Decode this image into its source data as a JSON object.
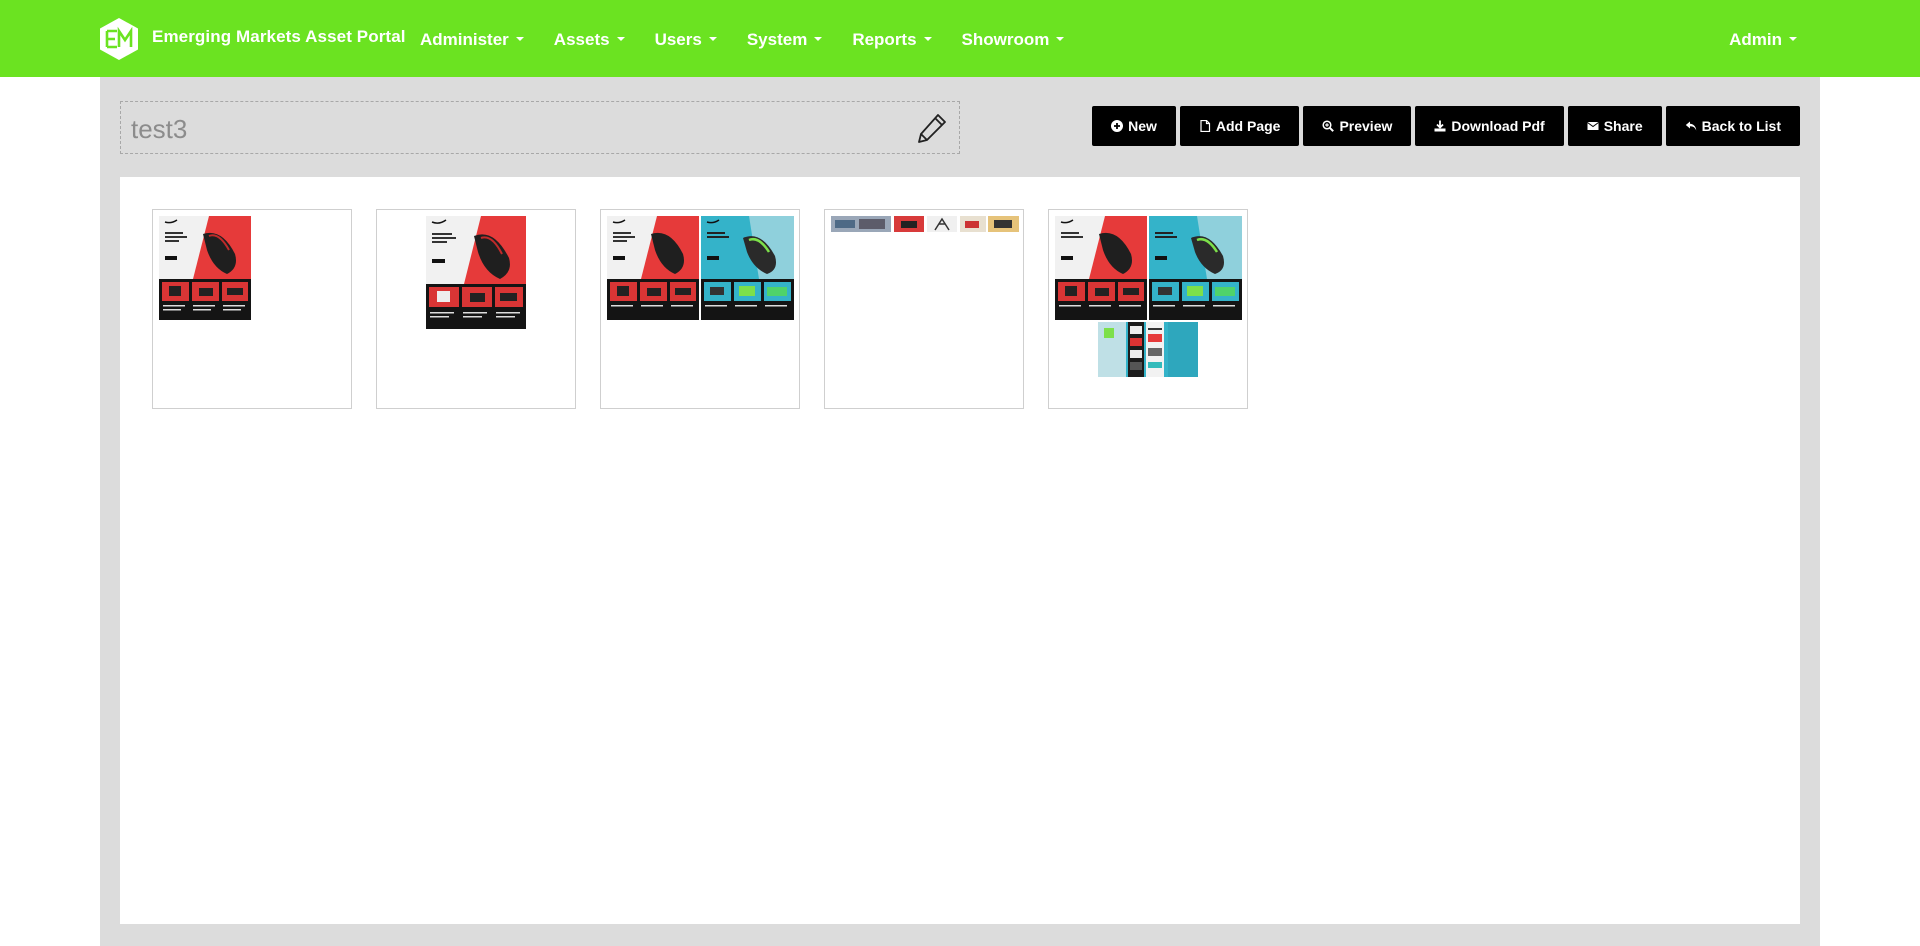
{
  "navbar": {
    "brand_title": "Emerging Markets Asset Portal",
    "items": [
      {
        "label": "Administer"
      },
      {
        "label": "Assets"
      },
      {
        "label": "Users"
      },
      {
        "label": "System"
      },
      {
        "label": "Reports"
      },
      {
        "label": "Showroom"
      }
    ],
    "user_menu": "Admin"
  },
  "document": {
    "title": "test3"
  },
  "toolbar": {
    "new_label": "New",
    "add_page_label": "Add Page",
    "preview_label": "Preview",
    "download_pdf_label": "Download Pdf",
    "share_label": "Share",
    "back_label": "Back to List"
  },
  "pages": [
    {
      "name": "page-1"
    },
    {
      "name": "page-2"
    },
    {
      "name": "page-3"
    },
    {
      "name": "page-4"
    },
    {
      "name": "page-5"
    }
  ],
  "colors": {
    "brand_green": "#6be321",
    "page_bg": "#dcdcdc",
    "button_bg": "#000000"
  },
  "icons": {
    "logo": "em-logo-icon",
    "edit": "pencil-icon",
    "new": "plus-circle-icon",
    "add_page": "file-icon",
    "preview": "zoom-in-icon",
    "download": "download-icon",
    "share": "envelope-icon",
    "back": "reply-icon"
  }
}
